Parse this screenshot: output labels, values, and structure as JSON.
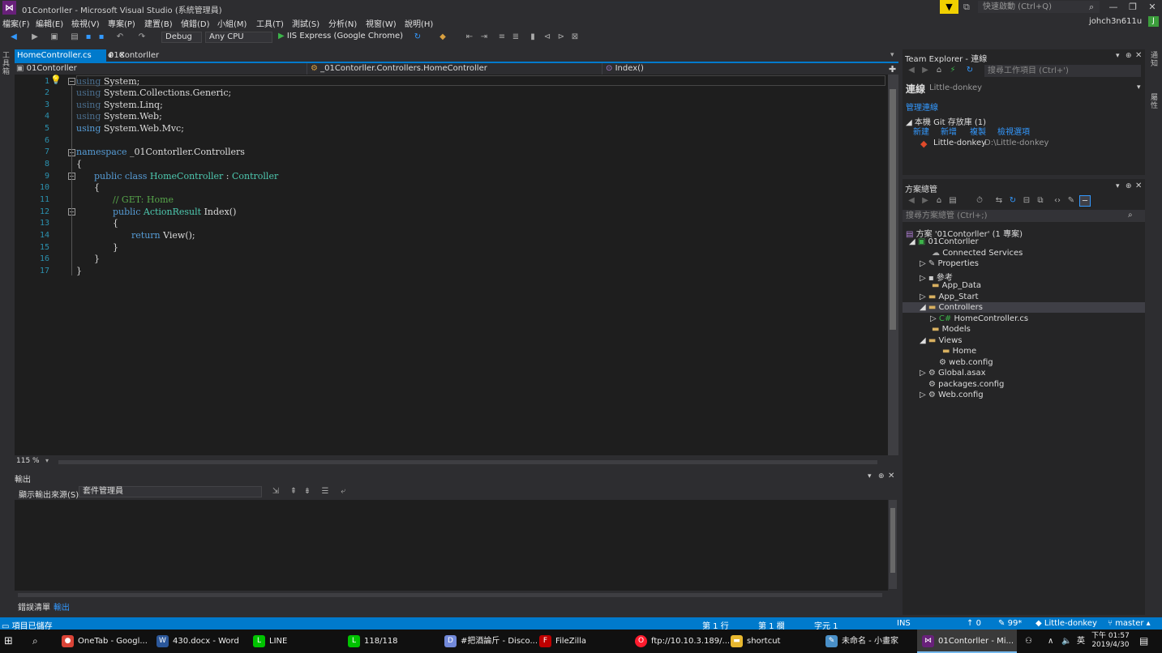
{
  "window": {
    "title": "01Contorller - Microsoft Visual Studio (系統管理員)",
    "quick_launch_placeholder": "快速啟動 (Ctrl+Q)",
    "user": "johch3n611u",
    "avatar_initial": "J"
  },
  "menu": [
    "檔案(F)",
    "編輯(E)",
    "檢視(V)",
    "專案(P)",
    "建置(B)",
    "偵錯(D)",
    "小組(M)",
    "工具(T)",
    "測試(S)",
    "分析(N)",
    "視窗(W)",
    "說明(H)"
  ],
  "toolbar": {
    "config": "Debug",
    "platform": "Any CPU",
    "run_target": "IIS Express (Google Chrome)"
  },
  "left_strip": {
    "label": "工具箱"
  },
  "right_strip": {
    "label1": "通知",
    "label2": "屬性"
  },
  "tabs": [
    {
      "label": "HomeController.cs",
      "active": true
    },
    {
      "label": "01Contorller",
      "active": false
    }
  ],
  "navbar": {
    "project": "01Contorller",
    "class": "_01Contorller.Controllers.HomeController",
    "member": "Index()"
  },
  "code_lines": [
    "1",
    "2",
    "3",
    "4",
    "5",
    "6",
    "7",
    "8",
    "9",
    "10",
    "11",
    "12",
    "13",
    "14",
    "15",
    "16",
    "17"
  ],
  "code": {
    "l1a": "using",
    "l1b": " System;",
    "l2a": "using",
    "l2b": " System.Collections.Generic;",
    "l3a": "using",
    "l3b": " System.Linq;",
    "l4a": "using",
    "l4b": " System.Web;",
    "l5a": "using",
    "l5b": " System.Web.Mvc;",
    "l7a": "namespace",
    "l7b": " _01Contorller.Controllers",
    "l8": "{",
    "l9a": "public class",
    "l9b": "HomeController",
    "l9c": " : ",
    "l9d": "Controller",
    "l10": "{",
    "l11": "// GET: Home",
    "l12a": "public",
    "l12b": "ActionResult",
    "l12c": " Index()",
    "l13": "{",
    "l14a": "return",
    "l14b": " View();",
    "l15": "}",
    "l16": "}",
    "l17": "}"
  },
  "zoom": "115 %",
  "output": {
    "title": "輸出",
    "source_label": "顯示輸出來源(S):",
    "source_value": "套件管理員"
  },
  "bottom_tabs": [
    "錯誤清單",
    "輸出"
  ],
  "team_explorer": {
    "title": "Team Explorer - 連線",
    "search_placeholder": "搜尋工作項目 (Ctrl+')",
    "section": "連線",
    "repo_context": "Little-donkey",
    "manage": "管理連線",
    "local_repos": "本機 Git 存放庫 (1)",
    "actions": [
      "新建",
      "新增",
      "複製",
      "檢視選項"
    ],
    "repo_name": "Little-donkey",
    "repo_path": "D:\\Little-donkey"
  },
  "solution_explorer": {
    "title": "方案總管",
    "search_placeholder": "搜尋方案總管 (Ctrl+;)",
    "items": [
      {
        "label": "方案 '01Contorller' (1 專案)"
      },
      {
        "label": "01Contorller"
      },
      {
        "label": "Connected Services"
      },
      {
        "label": "Properties"
      },
      {
        "label": "參考"
      },
      {
        "label": "App_Data"
      },
      {
        "label": "App_Start"
      },
      {
        "label": "Controllers"
      },
      {
        "label": "HomeController.cs"
      },
      {
        "label": "Models"
      },
      {
        "label": "Views"
      },
      {
        "label": "Home"
      },
      {
        "label": "web.config"
      },
      {
        "label": "Global.asax"
      },
      {
        "label": "packages.config"
      },
      {
        "label": "Web.config"
      }
    ]
  },
  "status": {
    "state": "項目已儲存",
    "line": "第 1 行",
    "col": "第 1 欄",
    "char": "字元 1",
    "ins": "INS",
    "push": "0",
    "changes": "99*",
    "repo": "Little-donkey",
    "branch": "master"
  },
  "taskbar": {
    "apps": [
      "OneTab - Googl...",
      "430.docx - Word",
      "LINE",
      "118/118",
      "#把酒論斤 - Disco...",
      "FileZilla",
      "ftp://10.10.3.189/...",
      "shortcut",
      "未命名 - 小畫家",
      "01Contorller - Mi..."
    ],
    "ime": "英",
    "time": "下午 01:57",
    "date": "2019/4/30"
  },
  "colors": {
    "accent": "#007acc",
    "editor_bg": "#1e1e1e",
    "keyword": "#569cd6",
    "type": "#4ec9b0",
    "comment": "#57a64a"
  }
}
